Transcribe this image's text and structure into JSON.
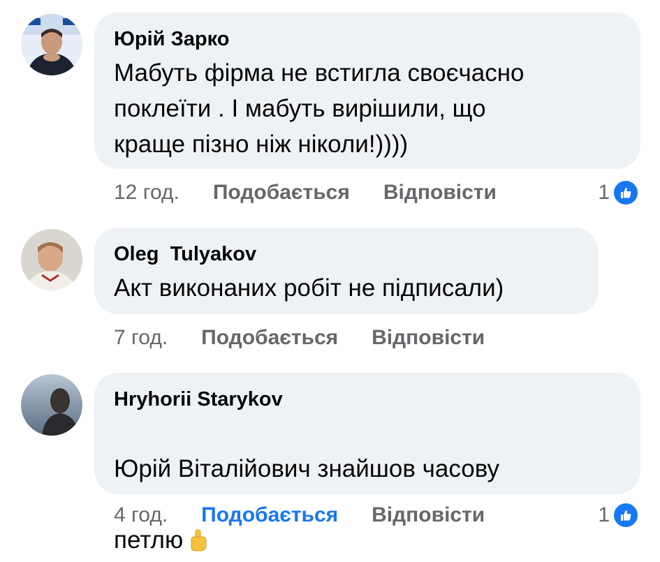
{
  "comments": [
    {
      "author": "Юрій Зарко",
      "text": "Мабуть фірма не встигла своєчасно\nпоклеїти . І мабуть вирішили, що\nкраще пізно ніж ніколи!))))",
      "time": "12 год.",
      "like_label": "Подобається",
      "reply_label": "Відповісти",
      "reaction_count": "1"
    },
    {
      "author": "Oleg  Tulyakov",
      "text": "Акт виконаних робіт не підписали)",
      "time": "7 год.",
      "like_label": "Подобається",
      "reply_label": "Відповісти"
    },
    {
      "author": "Hryhorii Starykov",
      "text_line1": "Юрій Віталійович знайшов часову",
      "text_line2": "петлю",
      "emoji": "pointing-up-hand-icon",
      "time": "4 год.",
      "like_label": "Подобається",
      "reply_label": "Відповісти",
      "reaction_count": "1"
    }
  ],
  "colors": {
    "bubble": "#eff2f5",
    "meta": "#65676b",
    "like_blue": "#1877f2"
  }
}
